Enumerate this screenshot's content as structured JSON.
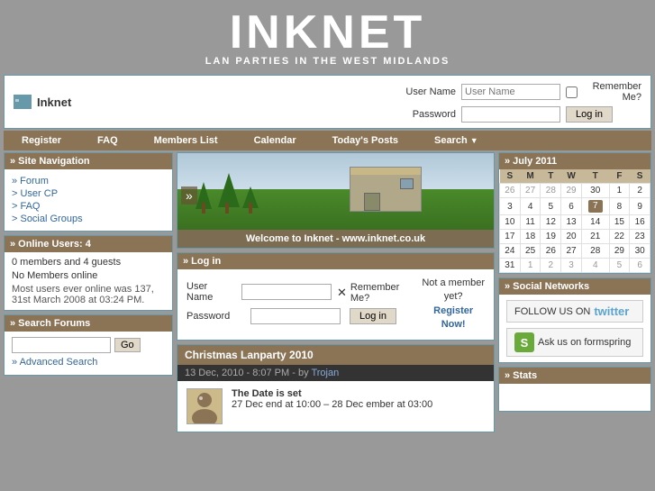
{
  "site": {
    "title": "INKNET",
    "subtitle": "LAN PARTIES IN THE WEST MIDLANDS"
  },
  "header": {
    "logo_text": "Inknet",
    "username_placeholder": "User Name",
    "password_label": "Password",
    "remember_label": "Remember Me?",
    "login_button": "Log in"
  },
  "nav": {
    "items": [
      "Register",
      "FAQ",
      "Members List",
      "Calendar",
      "Today's Posts",
      "Search"
    ]
  },
  "sidebar_left": {
    "site_nav_title": "» Site Navigation",
    "site_nav_links": [
      {
        "label": "» Forum",
        "href": "#"
      },
      {
        "label": "> User CP",
        "href": "#"
      },
      {
        "label": "> FAQ",
        "href": "#"
      },
      {
        "label": "> Social Groups",
        "href": "#"
      }
    ],
    "online_title": "» Online Users: 4",
    "online_text1": "0 members and 4 guests",
    "online_text2": "No Members online",
    "online_text3": "Most users ever online was 137, 31st March 2008 at 03:24 PM.",
    "search_title": "» Search Forums",
    "search_go": "Go",
    "advanced_search": "» Advanced Search"
  },
  "banner": {
    "caption": "Welcome to Inknet - www.inknet.co.uk"
  },
  "login_box": {
    "title": "» Log in",
    "username_label": "User Name",
    "password_label": "Password",
    "remember_label": "Remember Me?",
    "login_button": "Log in",
    "not_member": "Not a member yet?",
    "register": "Register Now!"
  },
  "post": {
    "title": "Christmas Lanparty 2010",
    "meta": "13 Dec, 2010 - 8:07 PM - by",
    "author": "Trojan",
    "subject": "The Date is set",
    "body": "27 Dec end at 10:00 – 28 Dec ember at 03:00"
  },
  "calendar": {
    "title": "» July 2011",
    "headers": [
      "S",
      "M",
      "T",
      "W",
      "T",
      "F",
      "S"
    ],
    "weeks": [
      [
        "26",
        "27",
        "28",
        "29",
        "30",
        "1",
        "2"
      ],
      [
        "3",
        "4",
        "5",
        "6",
        "7",
        "8",
        "9"
      ],
      [
        "10",
        "11",
        "12",
        "13",
        "14",
        "15",
        "16"
      ],
      [
        "17",
        "18",
        "19",
        "20",
        "21",
        "22",
        "23"
      ],
      [
        "24",
        "25",
        "26",
        "27",
        "28",
        "29",
        "30"
      ],
      [
        "31",
        "1",
        "2",
        "3",
        "4",
        "5",
        "6"
      ]
    ],
    "today": "7",
    "today_week": 1,
    "today_col": 4
  },
  "social": {
    "title": "» Social Networks",
    "follow_text": "FOLLOW US ON",
    "twitter_text": "twitter",
    "formspring_text": "Ask us on formspring"
  },
  "stats": {
    "title": "» Stats"
  }
}
